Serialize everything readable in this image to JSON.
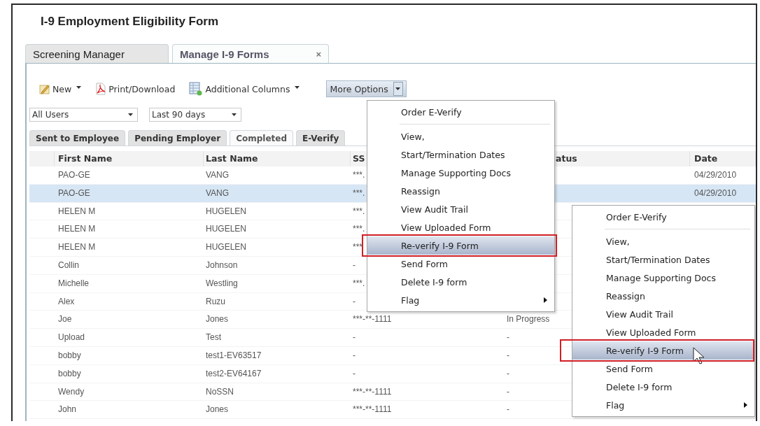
{
  "title": "I-9 Employment Eligibility Form",
  "tabs": [
    {
      "label": "Screening Manager",
      "selected": false,
      "closable": false
    },
    {
      "label": "Manage I-9 Forms",
      "selected": true,
      "closable": true,
      "close": "×"
    }
  ],
  "toolbar": [
    {
      "label": "New",
      "kind": "new",
      "dropdown": true
    },
    {
      "label": "Print/Download",
      "kind": "pdf",
      "dropdown": false
    },
    {
      "label": "Additional Columns",
      "kind": "columns",
      "dropdown": true
    },
    {
      "label": "More Options",
      "kind": "split",
      "dropdown": true,
      "active": true
    }
  ],
  "filters": [
    {
      "value": "All Users"
    },
    {
      "value": "Last 90 days"
    }
  ],
  "status_tabs": [
    {
      "label": "Sent to Employee",
      "selected": false
    },
    {
      "label": "Pending Employer",
      "selected": false
    },
    {
      "label": "Completed",
      "selected": true
    },
    {
      "label": "E-Verify",
      "selected": false
    }
  ],
  "table": {
    "columns": [
      "First Name",
      "Last Name",
      "SS",
      "atus",
      "Date"
    ],
    "rows": [
      {
        "selected": false,
        "cells": [
          "PAO-GE",
          "VANG",
          "***.",
          null,
          "04/29/2010"
        ]
      },
      {
        "selected": true,
        "cells": [
          "PAO-GE",
          "VANG",
          "***.",
          null,
          "04/29/2010"
        ]
      },
      {
        "selected": false,
        "cells": [
          "HELEN M",
          "HUGELEN",
          "***.",
          null,
          null
        ]
      },
      {
        "selected": false,
        "cells": [
          "HELEN M",
          "HUGELEN",
          "***.",
          null,
          null
        ]
      },
      {
        "selected": false,
        "cells": [
          "HELEN M",
          "HUGELEN",
          "***",
          null,
          null
        ]
      },
      {
        "selected": false,
        "cells": [
          "Collin",
          "Johnson",
          "-",
          null,
          null
        ]
      },
      {
        "selected": false,
        "cells": [
          "Michelle",
          "Westling",
          "***.",
          null,
          null
        ]
      },
      {
        "selected": false,
        "cells": [
          "Alex",
          "Ruzu",
          "-",
          null,
          null
        ]
      },
      {
        "selected": false,
        "cells": [
          "Joe",
          "Jones",
          "***-**-1111",
          "In Progress",
          null
        ]
      },
      {
        "selected": false,
        "cells": [
          "Upload",
          "Test",
          "-",
          "-",
          null
        ]
      },
      {
        "selected": false,
        "cells": [
          "bobby",
          "test1-EV63517",
          "-",
          "-",
          null
        ]
      },
      {
        "selected": false,
        "cells": [
          "bobby",
          "test2-EV64167",
          "-",
          "-",
          null
        ]
      },
      {
        "selected": false,
        "cells": [
          "Wendy",
          "NoSSN",
          "***-**-1111",
          "-",
          null
        ]
      },
      {
        "selected": false,
        "cells": [
          "John",
          "Jones",
          "***-**-1111",
          "-",
          null
        ]
      }
    ]
  },
  "menus": [
    {
      "cursor": false,
      "items": [
        {
          "kind": "item",
          "label": "Order E-Verify",
          "highlighted": false
        },
        {
          "kind": "separator"
        },
        {
          "kind": "item",
          "label": "View,",
          "highlighted": false
        },
        {
          "kind": "item",
          "label": "Start/Termination Dates",
          "highlighted": false
        },
        {
          "kind": "item",
          "label": "Manage Supporting Docs",
          "highlighted": false
        },
        {
          "kind": "item",
          "label": "Reassign",
          "highlighted": false
        },
        {
          "kind": "item",
          "label": "View Audit Trail",
          "highlighted": false
        },
        {
          "kind": "item",
          "label": "View Uploaded Form",
          "highlighted": false
        },
        {
          "kind": "item",
          "label": "Re-verify I-9 Form",
          "highlighted": true
        },
        {
          "kind": "item",
          "label": "Send Form",
          "highlighted": false
        },
        {
          "kind": "item",
          "label": "Delete I-9 form",
          "highlighted": false
        },
        {
          "kind": "submenu",
          "label": "Flag",
          "highlighted": false
        }
      ]
    },
    {
      "cursor": true,
      "items": [
        {
          "kind": "item",
          "label": "Order E-Verify",
          "highlighted": false
        },
        {
          "kind": "separator"
        },
        {
          "kind": "item",
          "label": "View,",
          "highlighted": false
        },
        {
          "kind": "item",
          "label": "Start/Termination Dates",
          "highlighted": false
        },
        {
          "kind": "item",
          "label": "Manage Supporting Docs",
          "highlighted": false
        },
        {
          "kind": "item",
          "label": "Reassign",
          "highlighted": false
        },
        {
          "kind": "item",
          "label": "View Audit Trail",
          "highlighted": false
        },
        {
          "kind": "item",
          "label": "View Uploaded Form",
          "highlighted": false
        },
        {
          "kind": "item",
          "label": "Re-verify I-9 Form",
          "highlighted": true
        },
        {
          "kind": "item",
          "label": "Send Form",
          "highlighted": false
        },
        {
          "kind": "item",
          "label": "Delete I-9 form",
          "highlighted": false
        },
        {
          "kind": "submenu",
          "label": "Flag",
          "highlighted": false
        }
      ]
    }
  ]
}
